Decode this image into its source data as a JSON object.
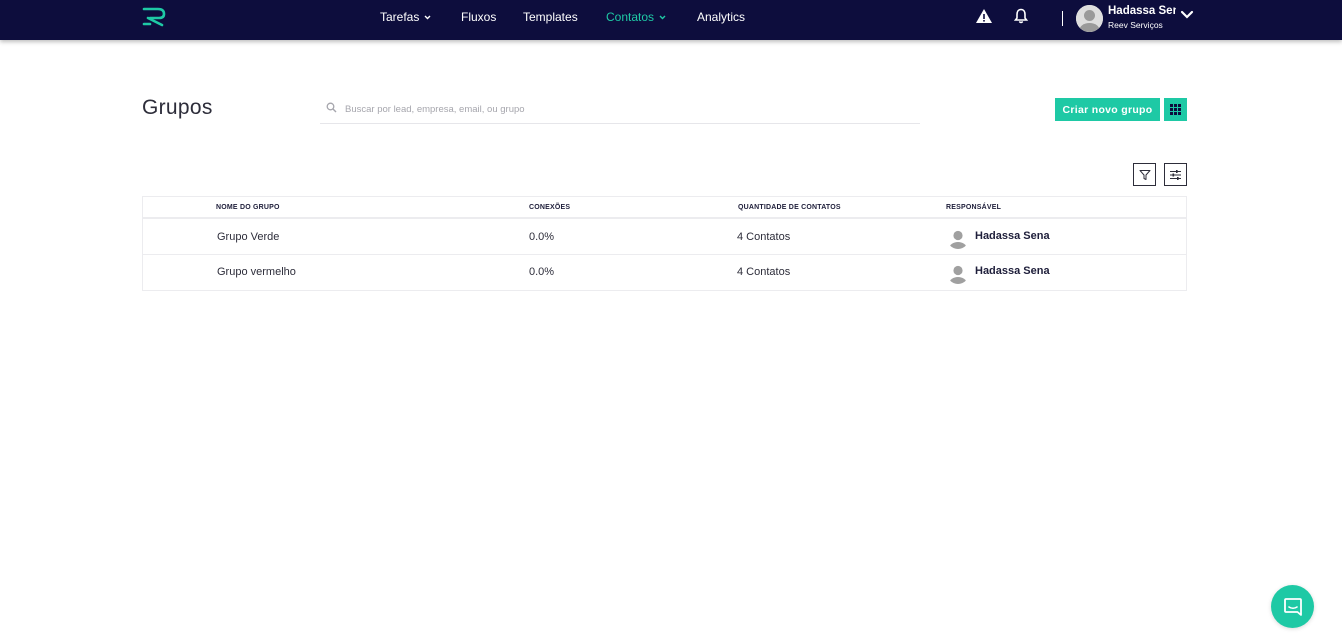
{
  "nav": {
    "items": [
      {
        "label": "Tarefas",
        "has_dropdown": true,
        "active": false
      },
      {
        "label": "Fluxos",
        "has_dropdown": false,
        "active": false
      },
      {
        "label": "Templates",
        "has_dropdown": false,
        "active": false
      },
      {
        "label": "Contatos",
        "has_dropdown": true,
        "active": true
      },
      {
        "label": "Analytics",
        "has_dropdown": false,
        "active": false
      }
    ],
    "icons": [
      "warning-icon",
      "bell-icon"
    ]
  },
  "user": {
    "name": "Hadassa Sena",
    "company": "Reev Serviços"
  },
  "page": {
    "title": "Grupos"
  },
  "search": {
    "placeholder": "Buscar por lead, empresa, email, ou grupo",
    "value": ""
  },
  "actions": {
    "create_label": "Criar novo grupo"
  },
  "table": {
    "columns": [
      "Nome do grupo",
      "Conexões",
      "Quantidade de contatos",
      "Responsável"
    ],
    "rows": [
      {
        "name": "Grupo Verde",
        "connections": "0.0%",
        "contacts": "4 Contatos",
        "owner": "Hadassa Sena"
      },
      {
        "name": "Grupo vermelho",
        "connections": "0.0%",
        "contacts": "4 Contatos",
        "owner": "Hadassa Sena"
      }
    ]
  },
  "colors": {
    "topbar": "#0d0d3d",
    "accent": "#1ec9a5",
    "text": "#2d2d3a"
  }
}
